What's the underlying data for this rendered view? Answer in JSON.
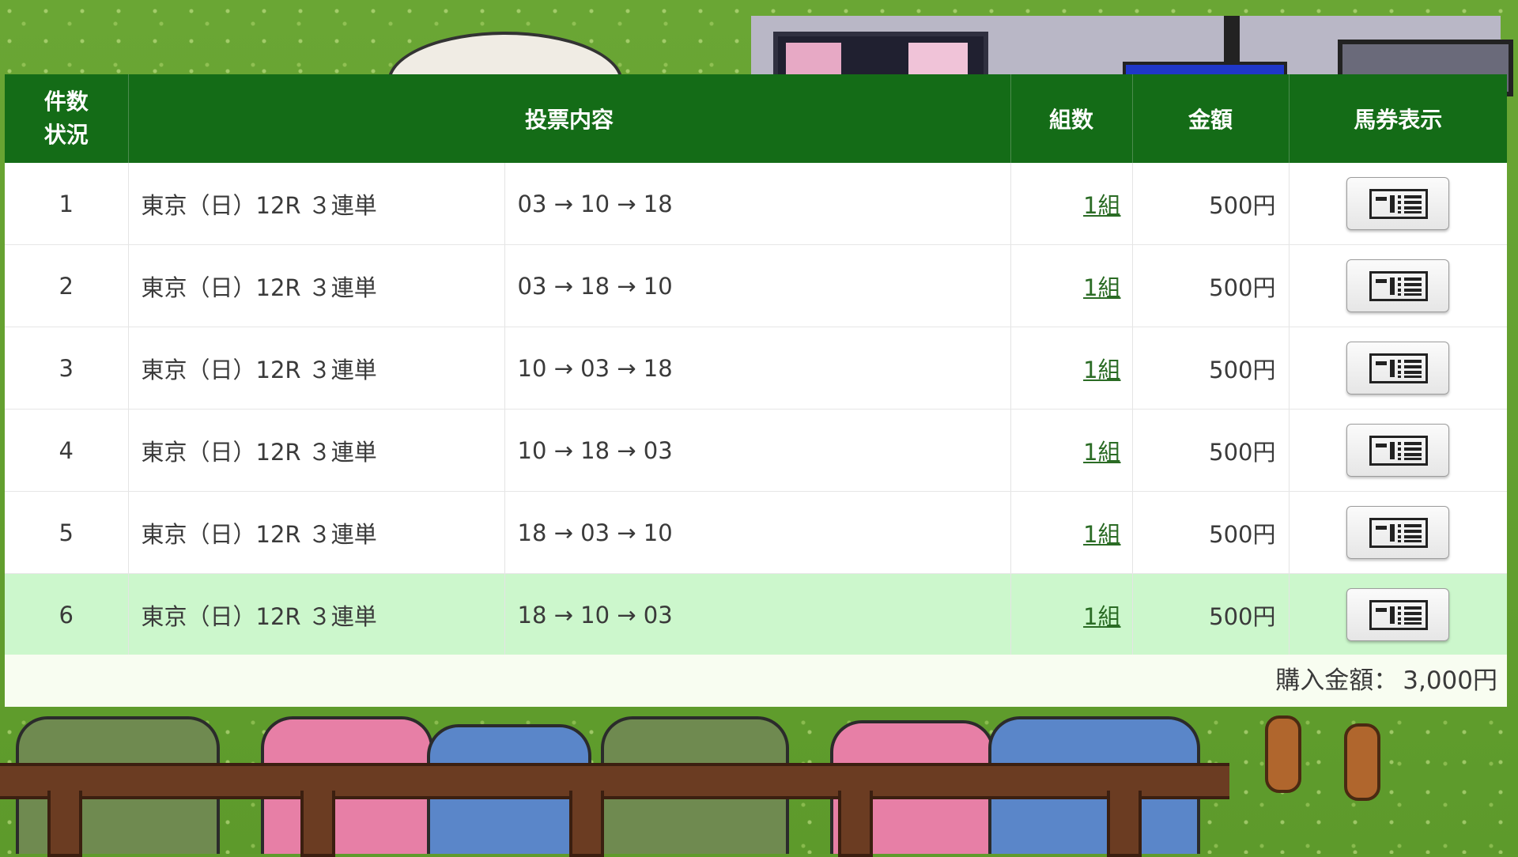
{
  "table": {
    "headers": {
      "count_line1": "件数",
      "count_line2": "状況",
      "content": "投票内容",
      "sets": "組数",
      "amount": "金額",
      "ticket": "馬券表示"
    },
    "rows": [
      {
        "num": "1",
        "race": "東京（日）12R ３連単",
        "combo": "03 → 10 → 18",
        "sets": "1組",
        "amount": "500円"
      },
      {
        "num": "2",
        "race": "東京（日）12R ３連単",
        "combo": "03 → 18 → 10",
        "sets": "1組",
        "amount": "500円"
      },
      {
        "num": "3",
        "race": "東京（日）12R ３連単",
        "combo": "10 → 03 → 18",
        "sets": "1組",
        "amount": "500円"
      },
      {
        "num": "4",
        "race": "東京（日）12R ３連単",
        "combo": "10 → 18 → 03",
        "sets": "1組",
        "amount": "500円"
      },
      {
        "num": "5",
        "race": "東京（日）12R ３連単",
        "combo": "18 → 03 → 10",
        "sets": "1組",
        "amount": "500円"
      },
      {
        "num": "6",
        "race": "東京（日）12R ３連単",
        "combo": "18 → 10 → 03",
        "sets": "1組",
        "amount": "500円"
      }
    ],
    "highlighted_row": 6
  },
  "total": {
    "label": "購入金額：",
    "value": "3,000円"
  },
  "icons": {
    "ticket_button": "ticket-view-icon"
  },
  "colors": {
    "header_bg": "#146c17",
    "highlight_row": "#ccf7cc",
    "link": "#2a6b24"
  }
}
